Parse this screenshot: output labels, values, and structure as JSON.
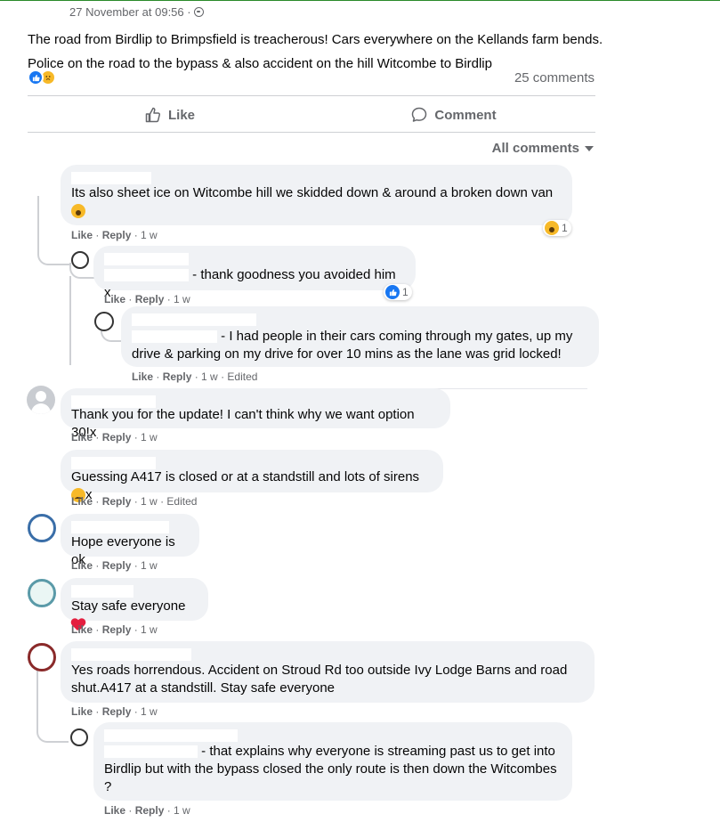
{
  "post": {
    "timestamp": "27 November at 09:56 ·",
    "text_line1": "The road from Birdlip to Brimpsfield is treacherous! Cars everywhere on the Kellands farm bends.",
    "text_line2": "Police on the road to the bypass & also accident on the hill Witcombe to Birdlip",
    "reactions": [
      "like-icon",
      "sad-icon"
    ],
    "comments_count": "25 comments"
  },
  "actions": {
    "like": "Like",
    "comment": "Comment"
  },
  "filter": {
    "label": "All comments"
  },
  "comments": [
    {
      "text_line1": "Its also sheet ice on Witcombe hill we skidded down & around a broken down van",
      "reaction_count": "1",
      "meta_like": "Like",
      "meta_reply": "Reply",
      "meta_time": "1 w"
    },
    {
      "text": "- thank goodness you avoided him x",
      "reaction_count": "1",
      "meta_like": "Like",
      "meta_reply": "Reply",
      "meta_time": "1 w"
    },
    {
      "text_line1": "- I had people in their cars coming through my gates, up my",
      "text_line2": "drive & parking on my drive for over 10 mins as the lane was grid locked!",
      "meta_like": "Like",
      "meta_reply": "Reply",
      "meta_time": "1 w",
      "meta_edited": "Edited"
    },
    {
      "text": "Thank you for the update! I can't think why we want option 30!x",
      "meta_like": "Like",
      "meta_reply": "Reply",
      "meta_time": "1 w"
    },
    {
      "text": "Guessing A417 is closed or at a standstill and lots of sirens",
      "text_suffix": "x",
      "meta_like": "Like",
      "meta_reply": "Reply",
      "meta_time": "1 w",
      "meta_edited": "Edited"
    },
    {
      "text": "Hope everyone is ok",
      "meta_like": "Like",
      "meta_reply": "Reply",
      "meta_time": "1 w"
    },
    {
      "text": "Stay safe everyone",
      "meta_like": "Like",
      "meta_reply": "Reply",
      "meta_time": "1 w"
    },
    {
      "text_line1": "Yes roads horrendous. Accident on Stroud Rd too outside Ivy Lodge Barns and road",
      "text_line2": "shut.A417 at a standstill. Stay safe everyone",
      "meta_like": "Like",
      "meta_reply": "Reply",
      "meta_time": "1 w"
    },
    {
      "text_line1": "- that explains why everyone is streaming past us to get into",
      "text_line2": "Birdlip but with the bypass closed the only route is then down the Witcombes",
      "text_line3": "?",
      "meta_like": "Like",
      "meta_reply": "Reply",
      "meta_time": "1 w"
    }
  ],
  "colors": {
    "accent": "#1877f2",
    "bubble": "#f0f2f5",
    "muted": "#65676b",
    "heart": "#e41e3f",
    "emoji": "#f7b928"
  }
}
